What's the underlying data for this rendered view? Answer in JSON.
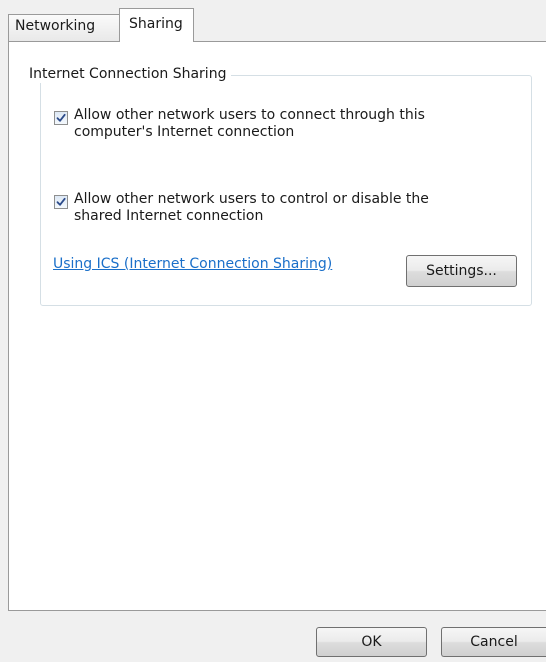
{
  "tabs": [
    {
      "label": "Networking",
      "selected": false
    },
    {
      "label": "Sharing",
      "selected": true
    }
  ],
  "groupbox": {
    "title": "Internet Connection Sharing"
  },
  "options": [
    {
      "label": "Allow other network users to connect through this computer's Internet connection",
      "checked": true
    },
    {
      "label": "Allow other network users to control or disable the shared Internet connection",
      "checked": true
    }
  ],
  "link": {
    "label": "Using ICS (Internet Connection Sharing)"
  },
  "buttons": {
    "settings": "Settings...",
    "ok": "OK",
    "cancel": "Cancel"
  },
  "colors": {
    "link": "#1a6fc9",
    "panel_background": "#ffffff",
    "dialog_background": "#f0f0f0",
    "checkmark": "#2b4a8a"
  },
  "icons": {
    "checkbox_mark": "checkmark-icon"
  }
}
